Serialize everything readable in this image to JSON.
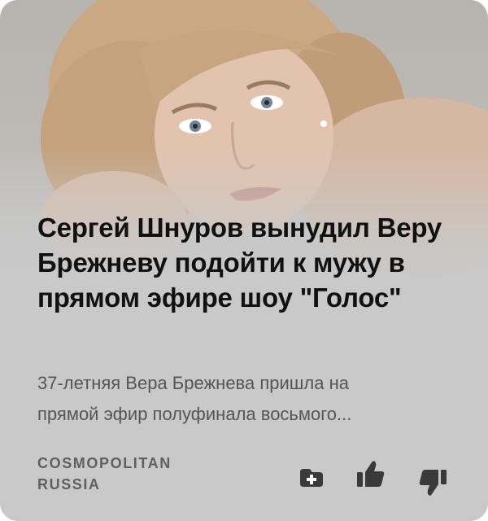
{
  "card": {
    "headline": "Сергей Шнуров вынудил Веру Брежневу подойти к мужу в прямом эфире шоу \"Голос\"",
    "lead_line_1": "37-летняя Вера Брежнева пришла на",
    "lead_line_2": "прямой эфир полуфинала восьмого...",
    "source_line_1": "COSMOPOLITAN",
    "source_line_2": "RUSSIA",
    "actions": {
      "add_icon": "plus-tab-icon",
      "like_icon": "thumbs-up-icon",
      "dislike_icon": "thumbs-down-icon"
    },
    "colors": {
      "background": "#c9c9c9",
      "headline": "#111111",
      "lead": "#555555",
      "source": "#606060",
      "icon": "#3a3a3a"
    }
  }
}
